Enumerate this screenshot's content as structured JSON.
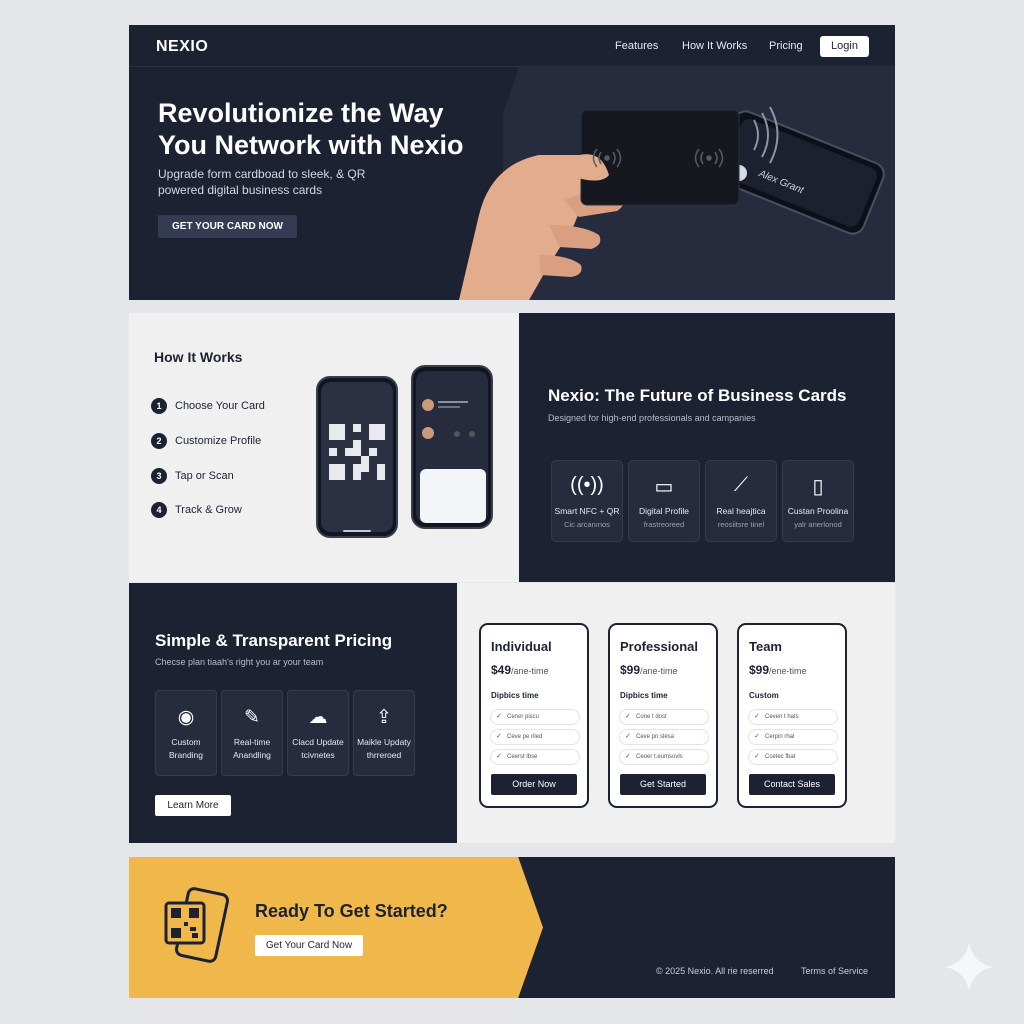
{
  "nav": {
    "logo": "NEXIO",
    "links": [
      "Features",
      "How It Works",
      "Pricing"
    ],
    "login": "Login"
  },
  "hero": {
    "title": "Revolutionize the Way You Network with Nexio",
    "subtitle": "Upgrade form cardboad to sleek, & QR powered digital business cards",
    "cta": "GET YOUR CARD NOW",
    "phone_name": "Alex Grant"
  },
  "how": {
    "title": "How It Works",
    "steps": [
      {
        "num": "1",
        "label": "Choose Your Card"
      },
      {
        "num": "2",
        "label": "Customize Profile"
      },
      {
        "num": "3",
        "label": "Tap or Scan"
      },
      {
        "num": "4",
        "label": "Track & Grow"
      }
    ]
  },
  "future": {
    "title": "Nexio: The Future of Business Cards",
    "subtitle": "Designed for high-end professionals and campanies",
    "features": [
      {
        "icon": "nfc-icon",
        "l1": "Smart NFC + QR",
        "l2": "Cic arcanınos"
      },
      {
        "icon": "briefcase-icon",
        "l1": "Digital Profile",
        "l2": "frastreoreed"
      },
      {
        "icon": "chart-icon",
        "l1": "Real heajtica",
        "l2": "reosiitsre tinel"
      },
      {
        "icon": "phone-icon",
        "l1": "Custan Proolina",
        "l2": "yalr anerlonod"
      }
    ]
  },
  "pricing": {
    "title": "Simple & Transparent Pricing",
    "subtitle": "Checse plan tiaah's right you ar your team",
    "features": [
      {
        "icon": "branding-icon",
        "l1": "Custom",
        "l2": "Branding"
      },
      {
        "icon": "edit-icon",
        "l1": "Real-time",
        "l2": "Anandling"
      },
      {
        "icon": "cloud-update-icon",
        "l1": "Clacd Update",
        "l2": "tcivnetes"
      },
      {
        "icon": "cloud-upload-icon",
        "l1": "Maikle Updaty",
        "l2": "thrreroed"
      }
    ],
    "learn_more": "Learn More",
    "plans": [
      {
        "name": "Individual",
        "price": "$49",
        "period": "/ane-time",
        "group": "Dipbics time",
        "rows": [
          "Cener piscu",
          "Ceve pe riled",
          "Ceerst lbse"
        ],
        "button": "Order Now"
      },
      {
        "name": "Professional",
        "price": "$99",
        "period": "/ane-time",
        "group": "Dipbics time",
        "rows": [
          "Cone t dost",
          "Ceve pn slesa",
          "Ceoer t.eumsovls"
        ],
        "button": "Get Started"
      },
      {
        "name": "Team",
        "price": "$99",
        "period": "/ene-time",
        "group": "Custom",
        "rows": [
          "Ceven t hats",
          "Cerpin rhal",
          "Ccetec fbat"
        ],
        "button": "Contact Sales"
      }
    ]
  },
  "cta": {
    "title": "Ready To Get Started?",
    "button": "Get Your Card Now"
  },
  "footer": {
    "copyright": "© 2025 Nexio. All rie reserred",
    "terms": "Terms of Service"
  },
  "colors": {
    "navy": "#1d2233",
    "panel": "#262c3d",
    "yellow": "#f0b84a",
    "light": "#f0f0f0"
  }
}
